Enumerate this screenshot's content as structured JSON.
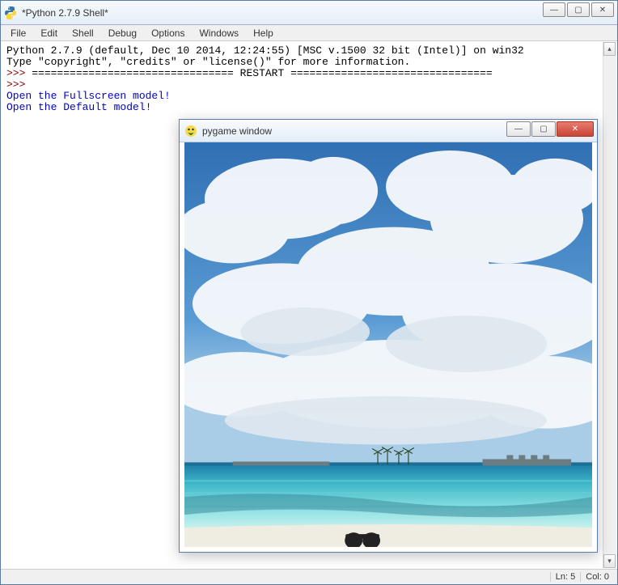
{
  "main_window": {
    "title": "*Python 2.7.9 Shell*",
    "menus": [
      "File",
      "Edit",
      "Shell",
      "Debug",
      "Options",
      "Windows",
      "Help"
    ],
    "controls": {
      "min": "—",
      "max": "▢",
      "close": "✕"
    }
  },
  "console": {
    "line1": "Python 2.7.9 (default, Dec 10 2014, 12:24:55) [MSC v.1500 32 bit (Intel)] on win32",
    "line2": "Type \"copyright\", \"credits\" or \"license()\" for more information.",
    "prompt": ">>> ",
    "restart_line": "================================ RESTART ================================",
    "out1": "Open the Fullscreen model!",
    "out2": "Open the Default model!"
  },
  "status": {
    "line": "Ln: 5",
    "col": "Col: 0"
  },
  "child_window": {
    "title": "pygame window",
    "controls": {
      "min": "—",
      "max": "▢",
      "close": "✕"
    },
    "image_description": "Tropical beach scene: blue sky with large white cumulus clouds, turquoise shallow water, distant palm trees and overwater huts on the horizon, sandy shoreline in foreground."
  }
}
